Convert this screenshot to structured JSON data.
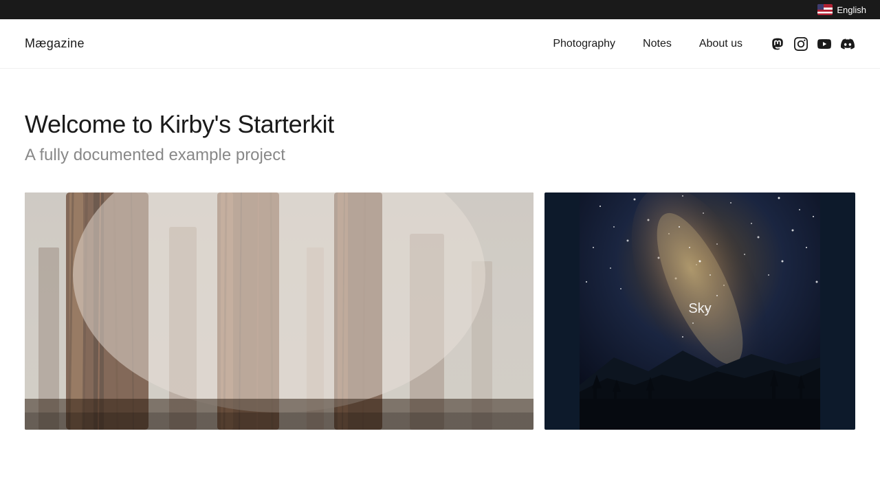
{
  "topbar": {
    "language_label": "English"
  },
  "header": {
    "logo": "Mægazine",
    "nav": {
      "items": [
        {
          "label": "Photography",
          "href": "#"
        },
        {
          "label": "Notes",
          "href": "#"
        },
        {
          "label": "About us",
          "href": "#"
        }
      ]
    },
    "social": [
      {
        "name": "mastodon",
        "label": "Mastodon"
      },
      {
        "name": "instagram",
        "label": "Instagram"
      },
      {
        "name": "youtube",
        "label": "YouTube"
      },
      {
        "name": "discord",
        "label": "Discord"
      }
    ]
  },
  "hero": {
    "title": "Welcome to Kirby's Starterkit",
    "subtitle": "A fully documented example project"
  },
  "gallery": {
    "items": [
      {
        "id": "forest",
        "label": "",
        "alt": "Forest with tall trees in fog"
      },
      {
        "id": "sky",
        "label": "Sky",
        "alt": "Night sky with Milky Way"
      }
    ]
  }
}
